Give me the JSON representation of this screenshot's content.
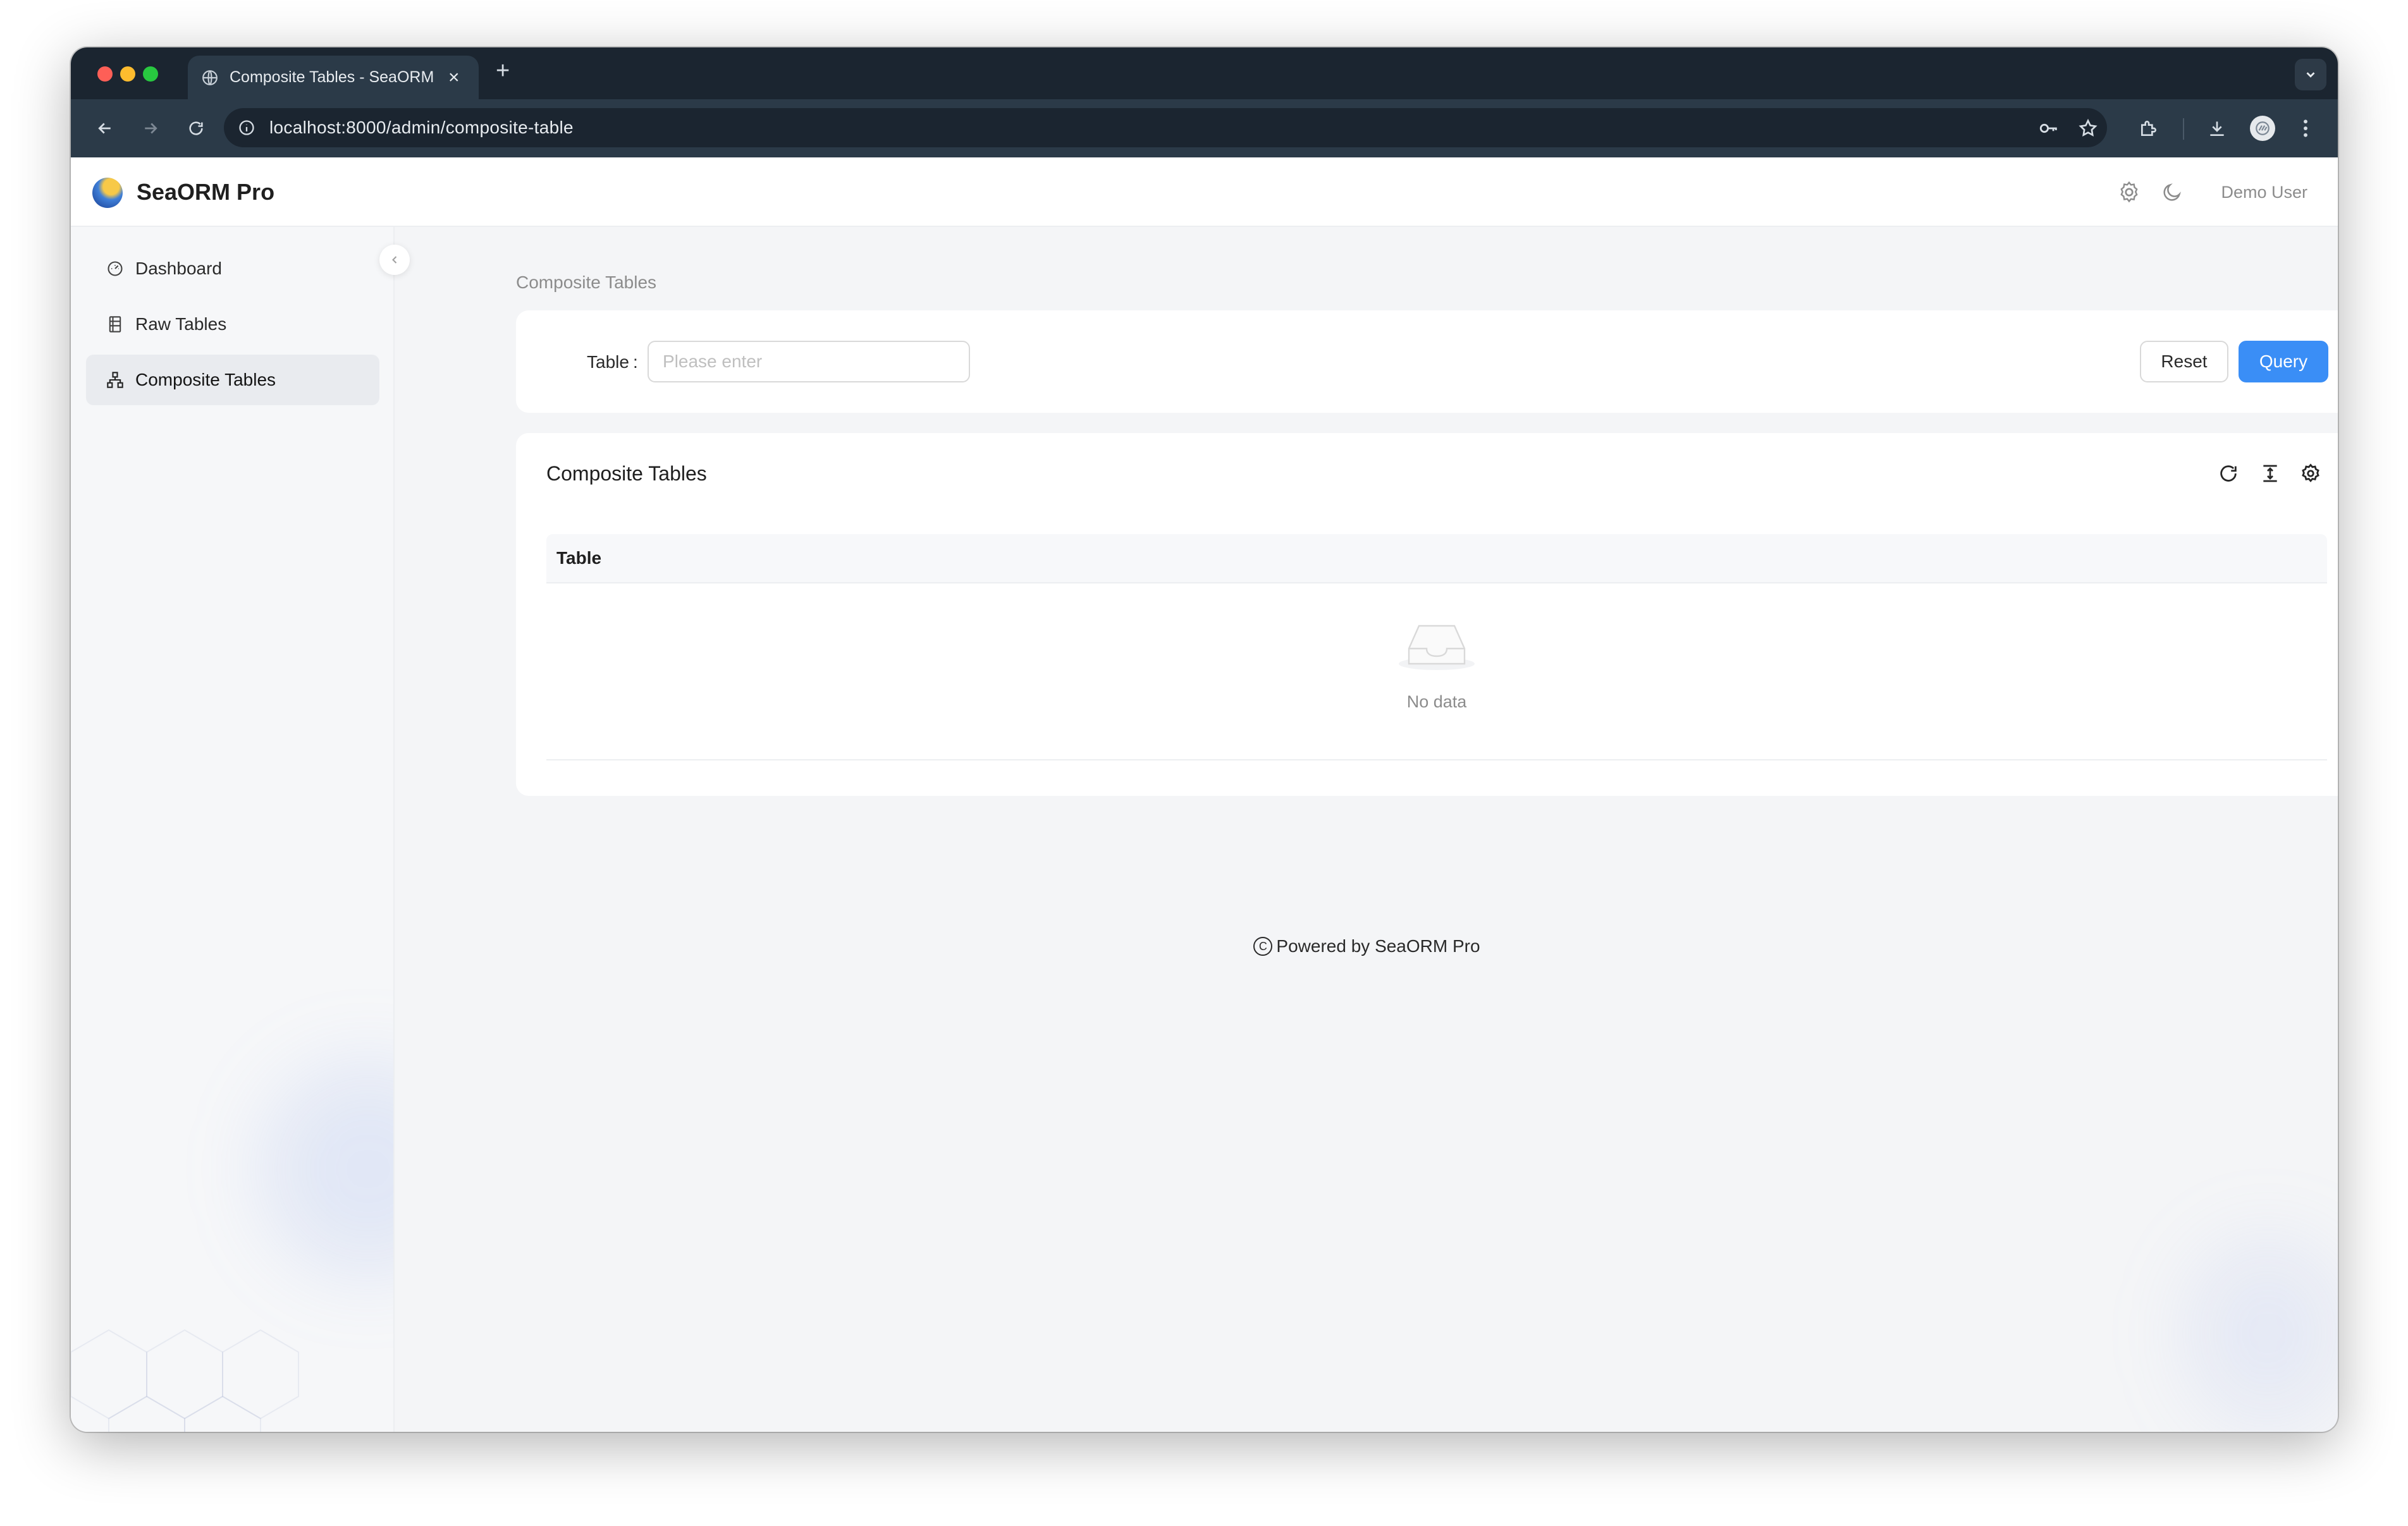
{
  "browser": {
    "tab_title": "Composite Tables - SeaORM Pro",
    "url": "localhost:8000/admin/composite-table",
    "traffic_colors": [
      "#fe5f57",
      "#febc2e",
      "#28c840"
    ]
  },
  "header": {
    "brand": "SeaORM Pro",
    "user": "Demo User"
  },
  "sidebar": {
    "items": [
      {
        "label": "Dashboard",
        "icon": "dashboard-icon",
        "active": false
      },
      {
        "label": "Raw Tables",
        "icon": "table-icon",
        "active": false
      },
      {
        "label": "Composite Tables",
        "icon": "cluster-icon",
        "active": true
      }
    ]
  },
  "main": {
    "breadcrumb": "Composite Tables",
    "search": {
      "label": "Table",
      "colon": ":",
      "placeholder": "Please enter",
      "value": "",
      "reset_label": "Reset",
      "query_label": "Query"
    },
    "table": {
      "title": "Composite Tables",
      "columns": [
        "Table"
      ],
      "rows": [],
      "empty_text": "No data"
    },
    "footer": "Powered by SeaORM Pro"
  },
  "colors": {
    "accent": "#3a8ef6",
    "chrome_dark": "#1b2530",
    "chrome_toolbar": "#2b3a48"
  }
}
